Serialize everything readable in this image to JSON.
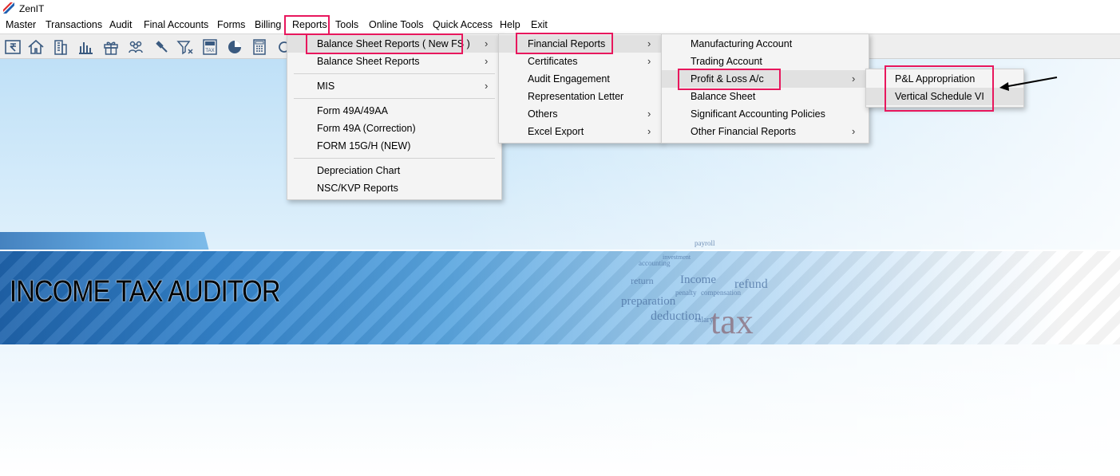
{
  "app": {
    "title": "ZenIT"
  },
  "menubar": [
    "Master",
    "Transactions",
    "Audit",
    "Final Accounts",
    "Forms",
    "Billing",
    "Reports",
    "Tools",
    "Online Tools",
    "Quick Access",
    "Help",
    "Exit"
  ],
  "toolbar": {
    "icons": [
      "rupee-icon",
      "home-icon",
      "building-icon",
      "bar-chart-icon",
      "gift-icon",
      "users-icon",
      "gavel-icon",
      "filter-icon",
      "tax-calculator-icon",
      "pie-chart-icon",
      "calculator-icon",
      "refresh-icon"
    ],
    "tax_label": "TAX"
  },
  "reports_menu": {
    "items": [
      "Balance Sheet Reports ( New FS )",
      "Balance Sheet Reports",
      "MIS",
      "Form 49A/49AA",
      "Form 49A (Correction)",
      "FORM 15G/H (NEW)",
      "Depreciation Chart",
      "NSC/KVP Reports"
    ]
  },
  "new_fs_menu": {
    "items": [
      "Financial Reports",
      "Certificates",
      "Audit Engagement",
      "Representation Letter",
      "Others",
      "Excel Export"
    ]
  },
  "financial_reports_menu": {
    "items": [
      "Manufacturing Account",
      "Trading Account",
      "Profit & Loss A/c",
      "Balance Sheet",
      "Significant Accounting Policies",
      "Other Financial Reports"
    ]
  },
  "pl_menu": {
    "items": [
      "P&L Appropriation",
      "Vertical Schedule VI"
    ]
  },
  "banner": {
    "title": "INCOME TAX AUDITOR",
    "words": [
      "payroll",
      "refund",
      "Income",
      "preparation",
      "deduction",
      "tax",
      "return",
      "salary",
      "penalty",
      "compensation",
      "accounting",
      "investment"
    ]
  },
  "colors": {
    "highlight": "#e8175d",
    "banner_blue": "#2a6fb5"
  }
}
